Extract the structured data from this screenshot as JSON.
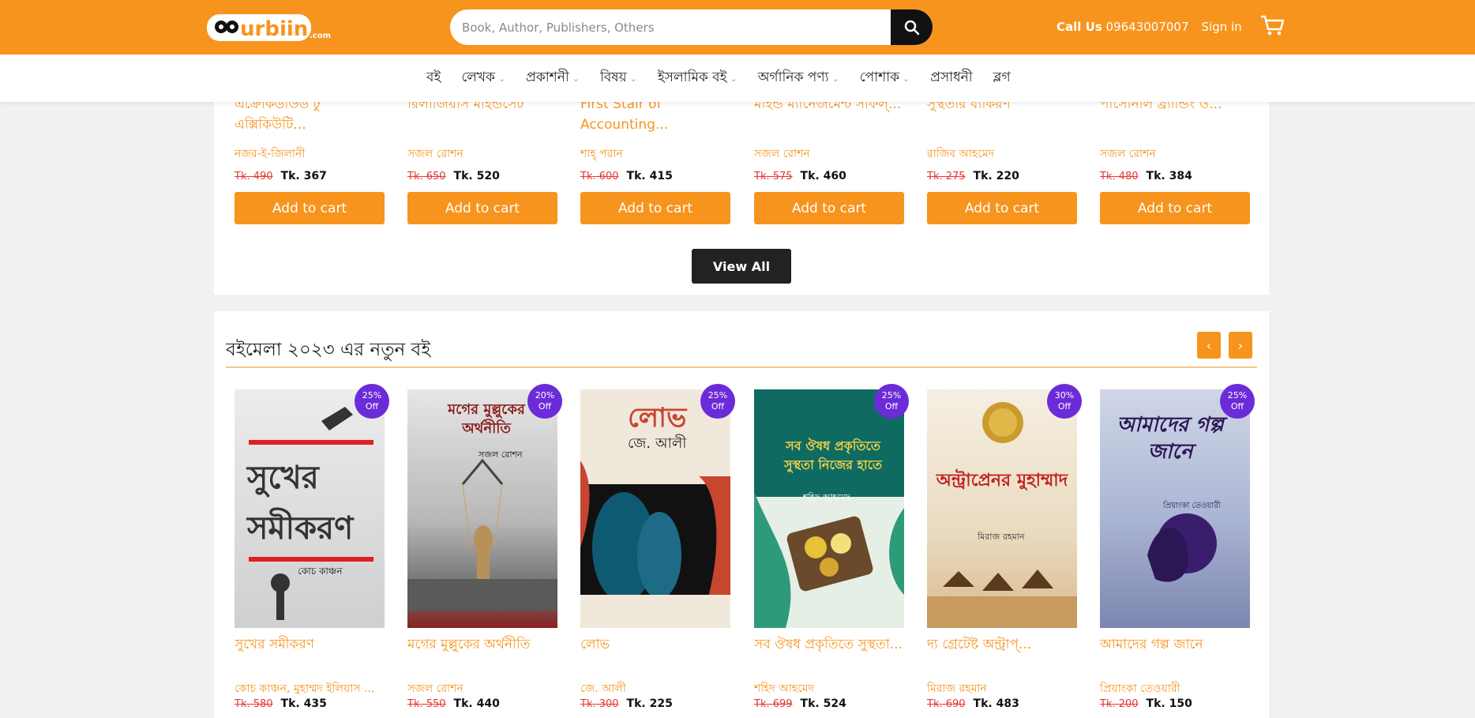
{
  "header": {
    "logo_text": "Durbiin",
    "logo_suffix": ".com",
    "search_placeholder": "Book, Author, Publishers, Others",
    "call_label": "Call Us",
    "call_number": "09643007007",
    "signin": "Sign in"
  },
  "nav": [
    {
      "label": "বই"
    },
    {
      "label": "লেখক"
    },
    {
      "label": "প্রকাশনী"
    },
    {
      "label": "বিষয়"
    },
    {
      "label": "ইসলামিক বই"
    },
    {
      "label": "অর্গানিক পণ্য"
    },
    {
      "label": "পোশাক"
    },
    {
      "label": "প্রসাধনী"
    },
    {
      "label": "ব্লগ"
    }
  ],
  "top_books": [
    {
      "title": "এক্রোকডাউড টু এক্সিকিউটি...",
      "author": "নজর-ই-জিলানী",
      "old_price": "Tk. 490",
      "price": "Tk. 367"
    },
    {
      "title": "রিলাজিয়াস মাইন্ডসেট",
      "author": "সজল রোশন",
      "old_price": "Tk. 650",
      "price": "Tk. 520"
    },
    {
      "title": "First Stair of Accounting...",
      "author": "শাহ্ পরান",
      "old_price": "Tk. 600",
      "price": "Tk. 415"
    },
    {
      "title": "মাইন্ড ম্যানেজমেন্ট সাফল্...",
      "author": "সজল রোশন",
      "old_price": "Tk. 575",
      "price": "Tk. 460"
    },
    {
      "title": "সুস্থতার ব্যাকরণ",
      "author": "রাজিব আহমেদ",
      "old_price": "Tk. 275",
      "price": "Tk. 220"
    },
    {
      "title": "পার্সোনাল ব্র্যান্ডিং ও...",
      "author": "সজল রোশন",
      "old_price": "Tk. 480",
      "price": "Tk. 384"
    }
  ],
  "add_to_cart": "Add to cart",
  "view_all": "View All",
  "new_section": {
    "title": "বইমেলা ২০২৩ এর নতুন বই",
    "prev": "‹",
    "next": "›",
    "books": [
      {
        "title": "সুখের সমীকরণ",
        "author": "কোচ কাঞ্চন, মুহাম্মদ ইলিয়াস ...",
        "old_price": "Tk. 580",
        "price": "Tk. 435",
        "discount": "25%",
        "off": "Off",
        "cover_text": "সুখের সমীকরণ",
        "cover_author": "কোচ কাঞ্চন"
      },
      {
        "title": "মগের মুল্লুকের অর্থনীতি",
        "author": "সজল রোশন",
        "old_price": "Tk. 550",
        "price": "Tk. 440",
        "discount": "20%",
        "off": "Off",
        "cover_text": "মগের মুল্লুকের অর্থনীতি",
        "cover_author": "সজল রোশন"
      },
      {
        "title": "লোভ",
        "author": "জে. আলী",
        "old_price": "Tk. 300",
        "price": "Tk. 225",
        "discount": "25%",
        "off": "Off",
        "cover_text": "লোভ",
        "cover_author": "জে. আলী"
      },
      {
        "title": "সব ঔষধ প্রকৃতিতে সুস্থতা...",
        "author": "শহিদ আহমেদ",
        "old_price": "Tk. 699",
        "price": "Tk. 524",
        "discount": "25%",
        "off": "Off",
        "cover_text": "সব ঔষধ প্রকৃতিতে সুস্থতা নিজের হাতে",
        "cover_author": "শহিদ আহমেদ"
      },
      {
        "title": "দ্য গ্রেটেষ্ট অন্ট্রাপ্...",
        "author": "মিরাজ রহমান",
        "old_price": "Tk. 690",
        "price": "Tk. 483",
        "discount": "30%",
        "off": "Off",
        "cover_text": "অন্ট্রাপ্রেনর মুহাম্মাদ",
        "cover_author": "মিরাজ রহমান"
      },
      {
        "title": "আমাদের গল্প জানে",
        "author": "প্রিয়াংকা তেওয়ারী",
        "old_price": "Tk. 200",
        "price": "Tk. 150",
        "discount": "25%",
        "off": "Off",
        "cover_text": "আমাদের গল্প জানে",
        "cover_author": "প্রিয়াংকা তেওয়ারী"
      }
    ]
  },
  "colors": {
    "brand": "#f7941d",
    "badge": "#6c2bd9",
    "dark": "#222222"
  }
}
